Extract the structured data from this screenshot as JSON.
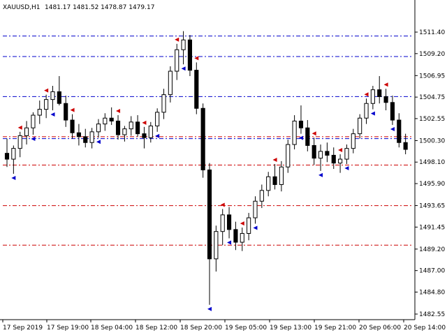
{
  "header": {
    "symbol": "XAUUSD,H1",
    "ohlc": "1481.17 1481.52 1478.87 1479.17"
  },
  "chart_data": {
    "type": "candlestick",
    "title": "",
    "xlabel": "",
    "ylabel": "",
    "ylim": [
      1482.55,
      1513.4
    ],
    "y_ticks": [
      "1511.40",
      "1509.20",
      "1506.95",
      "1504.75",
      "1502.55",
      "1500.30",
      "1498.10",
      "1495.90",
      "1493.65",
      "1491.45",
      "1489.20",
      "1487.00",
      "1484.80",
      "1482.55"
    ],
    "x_ticks": [
      "17 Sep 2019",
      "17 Sep 19:00",
      "18 Sep 04:00",
      "18 Sep 12:00",
      "18 Sep 20:00",
      "19 Sep 05:00",
      "19 Sep 13:00",
      "19 Sep 21:00",
      "20 Sep 06:00",
      "20 Sep 14:00"
    ],
    "grid": false,
    "colors": {
      "background": "#ffffff",
      "candle_bull_body": "#ffffff",
      "candle_bear_body": "#000000",
      "candle_outline": "#000000",
      "blue_level": "#0000cc",
      "red_level": "#cc0000",
      "light_blue_mark": "#6fa8dc",
      "pink_mark": "#ea8a8a"
    },
    "blue_levels": [
      1511.0,
      1508.9,
      1504.8,
      1500.5
    ],
    "red_levels": [
      1500.7,
      1497.8,
      1493.65,
      1489.6
    ],
    "candles": [
      [
        1499.0,
        1500.5,
        1497.6,
        1498.4
      ],
      [
        1498.4,
        1499.8,
        1496.9,
        1499.5
      ],
      [
        1499.5,
        1501.2,
        1498.6,
        1500.8
      ],
      [
        1500.8,
        1502.3,
        1499.9,
        1501.6
      ],
      [
        1501.6,
        1503.2,
        1500.9,
        1502.9
      ],
      [
        1502.9,
        1504.4,
        1502.0,
        1503.5
      ],
      [
        1503.5,
        1505.0,
        1502.6,
        1504.5
      ],
      [
        1504.5,
        1505.9,
        1503.4,
        1505.3
      ],
      [
        1505.3,
        1506.9,
        1503.9,
        1504.1
      ],
      [
        1504.1,
        1504.9,
        1501.7,
        1502.4
      ],
      [
        1502.4,
        1503.0,
        1500.5,
        1501.1
      ],
      [
        1501.1,
        1502.0,
        1499.8,
        1500.7
      ],
      [
        1500.7,
        1501.5,
        1499.6,
        1500.1
      ],
      [
        1500.1,
        1501.6,
        1499.5,
        1501.2
      ],
      [
        1501.2,
        1502.5,
        1500.6,
        1502.0
      ],
      [
        1502.0,
        1503.1,
        1501.3,
        1502.6
      ],
      [
        1502.6,
        1503.7,
        1501.9,
        1502.3
      ],
      [
        1502.3,
        1502.9,
        1500.4,
        1500.9
      ],
      [
        1500.9,
        1501.8,
        1500.2,
        1501.5
      ],
      [
        1501.5,
        1502.8,
        1500.8,
        1502.2
      ],
      [
        1502.2,
        1502.9,
        1500.7,
        1501.0
      ],
      [
        1501.0,
        1501.7,
        1499.5,
        1500.6
      ],
      [
        1500.6,
        1502.2,
        1500.1,
        1501.8
      ],
      [
        1501.8,
        1503.6,
        1501.2,
        1503.2
      ],
      [
        1503.2,
        1505.6,
        1502.5,
        1505.0
      ],
      [
        1505.0,
        1507.9,
        1504.2,
        1507.4
      ],
      [
        1507.4,
        1510.2,
        1506.5,
        1509.6
      ],
      [
        1509.6,
        1511.5,
        1508.1,
        1510.6
      ],
      [
        1510.6,
        1511.1,
        1506.9,
        1507.5
      ],
      [
        1507.5,
        1508.3,
        1503.0,
        1503.6
      ],
      [
        1503.6,
        1504.1,
        1496.5,
        1497.3
      ],
      [
        1497.3,
        1498.0,
        1483.5,
        1488.2
      ],
      [
        1488.2,
        1491.6,
        1486.9,
        1491.0
      ],
      [
        1491.0,
        1493.3,
        1489.6,
        1492.7
      ],
      [
        1492.7,
        1493.5,
        1490.3,
        1491.2
      ],
      [
        1491.2,
        1492.0,
        1489.1,
        1489.9
      ],
      [
        1489.9,
        1491.4,
        1489.0,
        1490.8
      ],
      [
        1490.8,
        1492.9,
        1490.1,
        1492.4
      ],
      [
        1492.4,
        1494.6,
        1491.8,
        1494.1
      ],
      [
        1494.1,
        1495.8,
        1493.4,
        1495.2
      ],
      [
        1495.2,
        1497.1,
        1494.6,
        1496.6
      ],
      [
        1496.6,
        1497.9,
        1495.3,
        1495.8
      ],
      [
        1495.8,
        1498.2,
        1495.1,
        1497.6
      ],
      [
        1497.6,
        1500.4,
        1497.0,
        1499.9
      ],
      [
        1499.9,
        1502.9,
        1499.4,
        1502.3
      ],
      [
        1502.3,
        1503.9,
        1501.0,
        1501.6
      ],
      [
        1501.6,
        1502.4,
        1499.2,
        1499.8
      ],
      [
        1499.8,
        1500.6,
        1497.8,
        1498.5
      ],
      [
        1498.5,
        1499.9,
        1497.2,
        1499.2
      ],
      [
        1499.2,
        1500.1,
        1498.1,
        1498.8
      ],
      [
        1498.8,
        1499.6,
        1497.4,
        1498.0
      ],
      [
        1498.0,
        1498.9,
        1497.0,
        1498.4
      ],
      [
        1498.4,
        1499.9,
        1497.9,
        1499.5
      ],
      [
        1499.5,
        1501.5,
        1499.0,
        1501.0
      ],
      [
        1501.0,
        1503.0,
        1500.5,
        1502.6
      ],
      [
        1502.6,
        1504.6,
        1502.0,
        1504.1
      ],
      [
        1504.1,
        1505.9,
        1503.5,
        1505.5
      ],
      [
        1505.5,
        1506.9,
        1504.1,
        1504.8
      ],
      [
        1504.8,
        1505.6,
        1503.4,
        1504.2
      ],
      [
        1504.2,
        1504.9,
        1501.9,
        1502.4
      ],
      [
        1502.4,
        1503.1,
        1499.6,
        1500.1
      ],
      [
        1500.1,
        1501.0,
        1498.9,
        1499.4
      ]
    ],
    "buy_markers": [
      1,
      4,
      7,
      14,
      23,
      27,
      31,
      34,
      38,
      45,
      48,
      52,
      56,
      59
    ],
    "sell_markers": [
      2,
      6,
      10,
      17,
      21,
      26,
      29,
      33,
      36,
      41,
      47,
      51,
      55,
      58
    ]
  }
}
